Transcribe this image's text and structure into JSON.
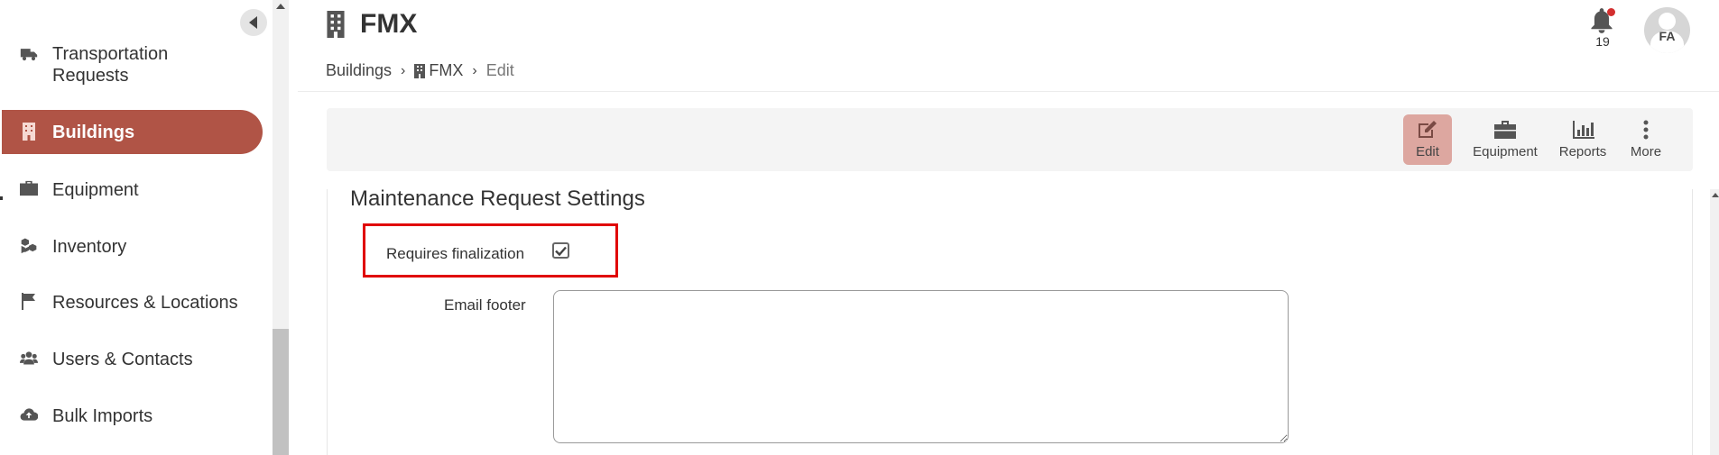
{
  "sidebar": {
    "collapse_icon": "chevron-left-icon",
    "items": [
      {
        "label": "Transportation Requests",
        "icon": "truck-icon"
      },
      {
        "label": "Buildings",
        "icon": "building-icon",
        "active": true
      },
      {
        "label": "Equipment",
        "icon": "briefcase-icon"
      },
      {
        "label": "Inventory",
        "icon": "cubes-icon"
      },
      {
        "label": "Resources & Locations",
        "icon": "flag-icon"
      },
      {
        "label": "Users & Contacts",
        "icon": "users-icon"
      },
      {
        "label": "Bulk Imports",
        "icon": "cloud-upload-icon"
      }
    ]
  },
  "header": {
    "title": "FMX",
    "title_icon": "building-icon",
    "breadcrumb": {
      "root": "Buildings",
      "building": "FMX",
      "current": "Edit"
    },
    "notifications": {
      "count": "19",
      "icon": "bell-icon"
    },
    "avatar": {
      "initials": "FA"
    }
  },
  "toolbar": {
    "items": [
      {
        "label": "Edit",
        "icon": "edit-icon",
        "active": true
      },
      {
        "label": "Equipment",
        "icon": "briefcase-icon"
      },
      {
        "label": "Reports",
        "icon": "bar-chart-icon"
      },
      {
        "label": "More",
        "icon": "more-vertical-icon"
      }
    ]
  },
  "form": {
    "section_title": "Maintenance Request Settings",
    "requires_finalization": {
      "label": "Requires finalization",
      "checked": true
    },
    "email_footer": {
      "label": "Email footer",
      "value": ""
    }
  },
  "colors": {
    "accent": "#b05446",
    "active_tool": "#dda7a0",
    "highlight": "#e00000"
  }
}
